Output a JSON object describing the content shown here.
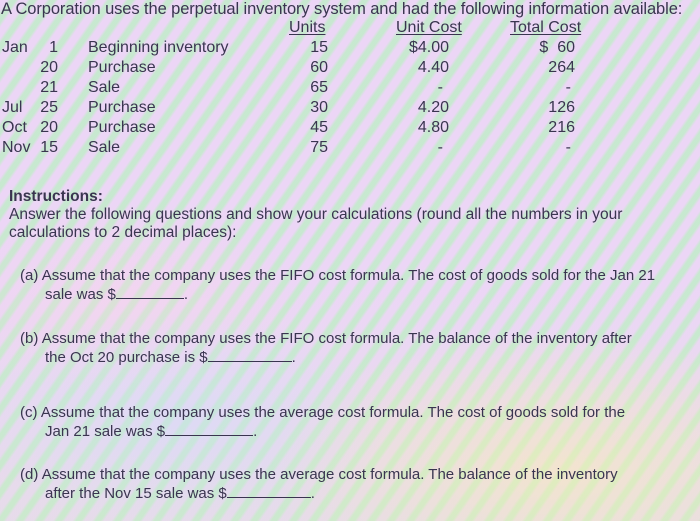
{
  "title": "A Corporation uses the perpetual inventory system and had the following information available:",
  "table": {
    "headers": {
      "units": "Units",
      "unit_cost": "Unit Cost",
      "total_cost": "Total Cost"
    },
    "rows": [
      {
        "month": "Jan",
        "day": "1",
        "description": "Beginning inventory",
        "units": "15",
        "unit_cost": "$4.00",
        "total_cost": "$  60"
      },
      {
        "month": "",
        "day": "20",
        "description": "Purchase",
        "units": "60",
        "unit_cost": "4.40",
        "total_cost": "264"
      },
      {
        "month": "",
        "day": "21",
        "description": "Sale",
        "units": "65",
        "unit_cost": "-",
        "total_cost": "-"
      },
      {
        "month": "Jul",
        "day": "25",
        "description": "Purchase",
        "units": "30",
        "unit_cost": "4.20",
        "total_cost": "126"
      },
      {
        "month": "Oct",
        "day": "20",
        "description": "Purchase",
        "units": "45",
        "unit_cost": "4.80",
        "total_cost": "216"
      },
      {
        "month": "Nov",
        "day": "15",
        "description": "Sale",
        "units": "75",
        "unit_cost": "-",
        "total_cost": "-"
      }
    ]
  },
  "instructions": {
    "heading": "Instructions:",
    "body": "Answer the following questions and show your calculations (round all the numbers in your calculations to 2 decimal places):"
  },
  "questions": [
    {
      "label": "(a)",
      "line1": "Assume that the company uses the FIFO cost formula. The cost of goods sold for the Jan 21",
      "line2": "sale was $",
      "suffix": "."
    },
    {
      "label": "(b)",
      "line1": "Assume that the company uses the FIFO cost formula. The balance of the inventory after",
      "line2": "the Oct 20 purchase is $",
      "suffix": "."
    },
    {
      "label": "(c)",
      "line1": "Assume that the company uses the average cost formula. The cost of goods sold for the",
      "line2": "Jan 21 sale was $",
      "suffix": "."
    },
    {
      "label": "(d)",
      "line1": "Assume that the company uses the average cost formula. The balance of the inventory",
      "line2": "after the Nov 15 sale was $",
      "suffix": "."
    }
  ]
}
